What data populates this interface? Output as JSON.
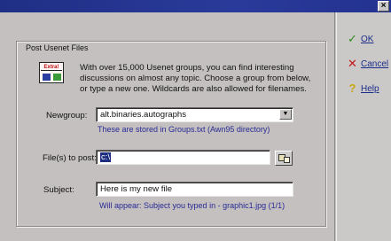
{
  "window": {
    "close_symbol": "×",
    "close_icon": "close-icon"
  },
  "group": {
    "title": "Post Usenet Files"
  },
  "info": {
    "icon": "usenet-files-icon",
    "icon_caption": "Extra!",
    "text": "With over 15,000 Usenet groups, you can find interesting discussions on almost any topic.  Choose a group from below, or type a new one.  Wildcards are also allowed for filenames."
  },
  "newsgroup": {
    "label": "Newgroup:",
    "value": "alt.binaries.autographs",
    "hint": "These are stored in Groups.txt  (Awn95 directory)",
    "dropdown_symbol": "▼"
  },
  "files": {
    "label": "File(s) to post:",
    "value": "c:\\",
    "browse_icon": "browse-folder-icon"
  },
  "subject": {
    "label": "Subject:",
    "value": "Here is my new file",
    "hint": "Will appear:  Subject you typed in  - graphic1.jpg (1/1)"
  },
  "actions": {
    "ok_symbol": "✓",
    "ok_label": "OK",
    "cancel_symbol": "✕",
    "cancel_label": "Cancel",
    "help_symbol": "?",
    "help_label": "Help"
  },
  "colors": {
    "titlebar": "#1f2f85",
    "hint_text": "#2a2a96",
    "selection": "#1d2d7f",
    "ok": "#2c8a1c",
    "cancel": "#c2181c",
    "help": "#c8a812"
  }
}
